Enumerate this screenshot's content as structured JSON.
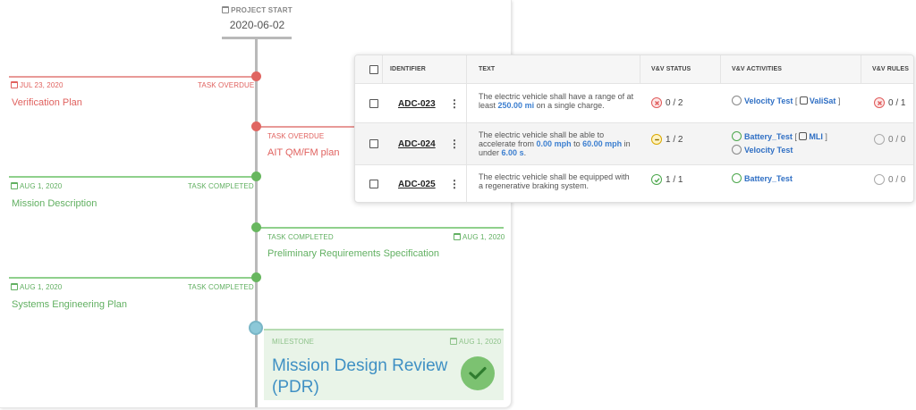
{
  "timeline": {
    "start": {
      "label": "PROJECT START",
      "date": "2020-06-02"
    },
    "items": [
      {
        "date": "JUL 23, 2020",
        "status": "TASK OVERDUE",
        "title": "Verification Plan"
      },
      {
        "date": "",
        "status": "TASK OVERDUE",
        "title": "AIT QM/FM plan"
      },
      {
        "date": "AUG 1, 2020",
        "status": "TASK COMPLETED",
        "title": "Mission Description"
      },
      {
        "date": "AUG 1, 2020",
        "status": "TASK COMPLETED",
        "title": "Preliminary Requirements Specification"
      },
      {
        "date": "AUG 1, 2020",
        "status": "TASK COMPLETED",
        "title": "Systems Engineering Plan"
      }
    ],
    "milestone": {
      "label": "MILESTONE",
      "date": "AUG 1, 2020",
      "title": "Mission Design Review (PDR)"
    }
  },
  "table": {
    "headers": {
      "identifier": "IDENTIFIER",
      "text": "TEXT",
      "status": "V&V STATUS",
      "activities": "V&V ACTIVITIES",
      "rules": "V&V RULES"
    },
    "rows": [
      {
        "id": "ADC-023",
        "text_a": "The electric vehicle shall have a range of at least ",
        "v1": "250.00",
        "u1": "mi",
        "text_b": " on a single charge.",
        "status": "0 / 2",
        "act1": "Velocity Test",
        "tool1": "ValiSat",
        "rules": "0 / 1"
      },
      {
        "id": "ADC-024",
        "text_a": "The electric vehicle shall be able to accelerate from ",
        "v1": "0.00",
        "u1": "mph",
        "mid": " to ",
        "v2": "60.00",
        "u2": "mph",
        "mid2": " in under ",
        "v3": "6.00",
        "u3": "s",
        "end": ".",
        "status": "1 / 2",
        "act1": "Battery_Test",
        "tool1": "MLI",
        "act2": "Velocity Test",
        "rules": "0 / 0"
      },
      {
        "id": "ADC-025",
        "text": "The electric vehicle shall be equipped with a regenerative braking system.",
        "status": "1 / 1",
        "act1": "Battery_Test",
        "rules": "0 / 0"
      }
    ]
  },
  "colors": {
    "overdue": "#e0625f",
    "completed": "#62b062",
    "milestone": "#3f90c4",
    "link": "#2f6fc4"
  }
}
